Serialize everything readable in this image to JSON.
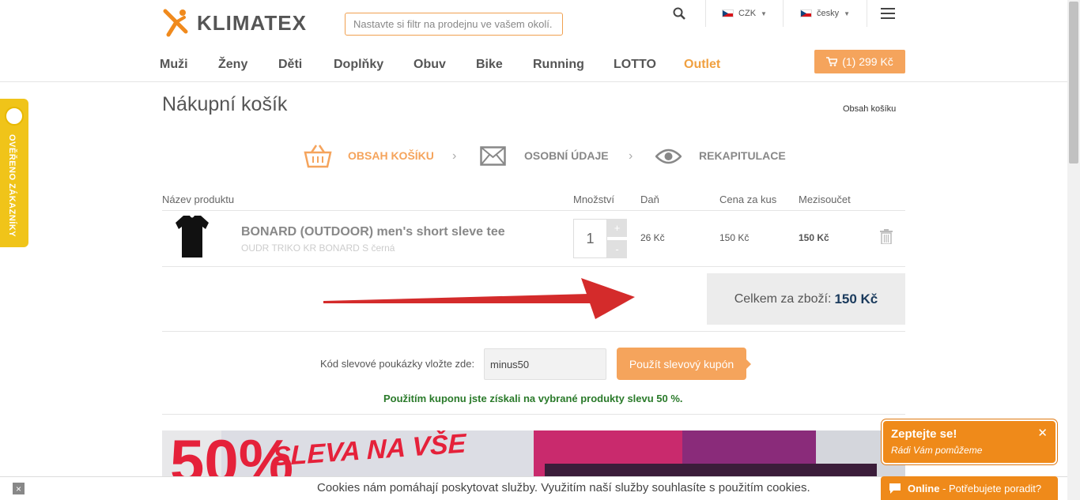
{
  "header": {
    "logo_text": "KLIMATEX",
    "store_filter": "Nastavte si filtr na prodejnu ve vašem okolí.",
    "currency": "CZK",
    "language": "česky",
    "cart_label": "(1) 299 Kč"
  },
  "nav": [
    "Muži",
    "Ženy",
    "Děti",
    "Doplňky",
    "Obuv",
    "Bike",
    "Running",
    "LOTTO",
    "Outlet"
  ],
  "badge": {
    "text": "OVĚŘENO ZÁKAZNÍKY"
  },
  "page": {
    "title": "Nákupní košík",
    "breadcrumb": "Obsah košíku"
  },
  "steps": [
    {
      "label": "OBSAH KOŠÍKU",
      "icon": "basket-icon",
      "active": true
    },
    {
      "label": "OSOBNÍ ÚDAJE",
      "icon": "envelope-icon",
      "active": false
    },
    {
      "label": "REKAPITULACE",
      "icon": "eye-icon",
      "active": false
    }
  ],
  "table": {
    "headers": {
      "product": "Název produktu",
      "qty": "Množství",
      "tax": "Daň",
      "unit_price": "Cena za kus",
      "subtotal": "Mezisoučet"
    },
    "rows": [
      {
        "name": "BONARD (OUTDOOR) men's short sleve tee",
        "variant": "OUDR TRIKO KR BONARD S černá",
        "qty": "1",
        "tax": "26 Kč",
        "unit_price": "150 Kč",
        "subtotal": "150 Kč"
      }
    ]
  },
  "total": {
    "label": "Celkem za zboží:",
    "value": "150 Kč"
  },
  "coupon": {
    "label": "Kód slevové poukázky vložte zde:",
    "value": "minus50",
    "button": "Použít slevový kupón",
    "message": "Použitím kuponu jste získali na vybrané produkty slevu 50 %."
  },
  "banner": {
    "big": "50%",
    "text": "SLEVA NA VŠE"
  },
  "cookie": {
    "text": "Cookies nám pomáhají poskytovat služby. Využitím naší služby souhlasíte s použitím cookies.",
    "close": "×"
  },
  "chat": {
    "title": "Zeptejte se!",
    "subtitle": "Rádi Vám pomůžeme",
    "online_label": "Online",
    "online_text": " - Potřebujete poradit?"
  },
  "colors": {
    "accent": "#f5a45c",
    "outlet": "#f0a040",
    "success": "#2a7a2a",
    "arrow": "#d42b2b"
  }
}
